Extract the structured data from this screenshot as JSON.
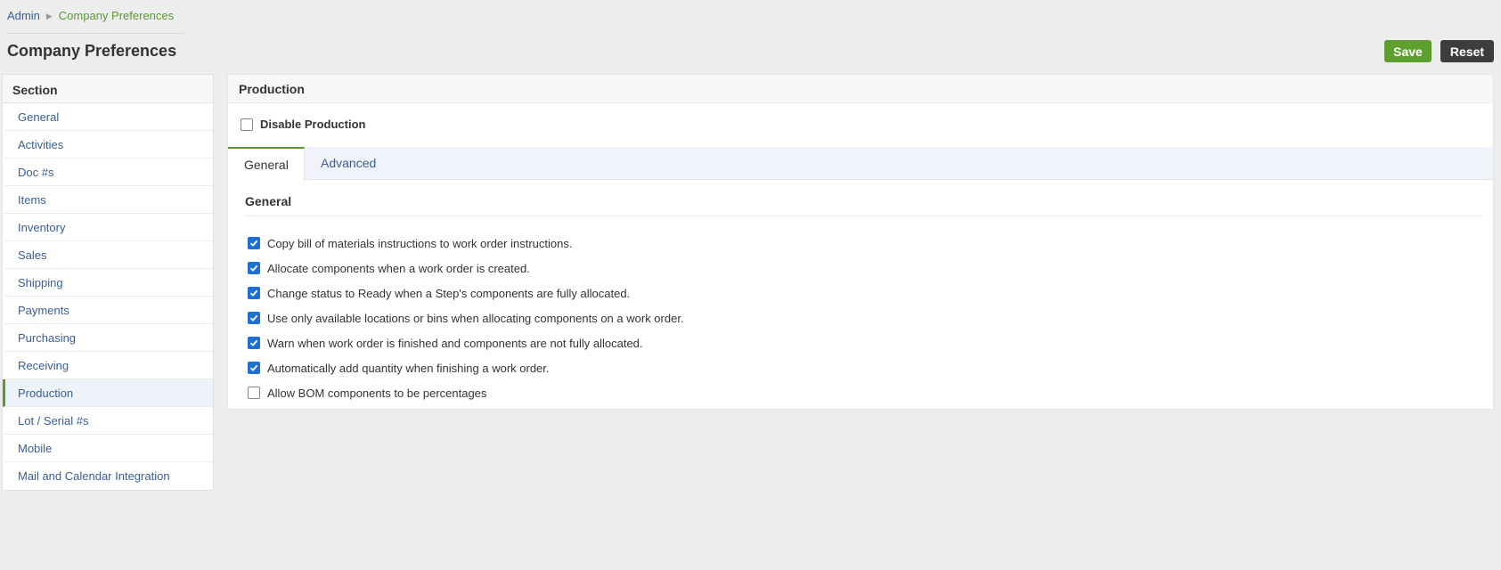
{
  "breadcrumb": {
    "root": "Admin",
    "current": "Company Preferences"
  },
  "page_title": "Company Preferences",
  "actions": {
    "save": "Save",
    "reset": "Reset"
  },
  "sidebar": {
    "header": "Section",
    "items": [
      {
        "label": "General"
      },
      {
        "label": "Activities"
      },
      {
        "label": "Doc #s"
      },
      {
        "label": "Items"
      },
      {
        "label": "Inventory"
      },
      {
        "label": "Sales"
      },
      {
        "label": "Shipping"
      },
      {
        "label": "Payments"
      },
      {
        "label": "Purchasing"
      },
      {
        "label": "Receiving"
      },
      {
        "label": "Production",
        "active": true
      },
      {
        "label": "Lot / Serial #s"
      },
      {
        "label": "Mobile"
      },
      {
        "label": "Mail and Calendar Integration"
      }
    ]
  },
  "panel": {
    "title": "Production",
    "disable_label": "Disable Production",
    "disable_checked": false,
    "tabs": [
      {
        "label": "General",
        "active": true
      },
      {
        "label": "Advanced",
        "active": false
      }
    ],
    "section_title": "General",
    "options": [
      {
        "label": "Copy bill of materials instructions to work order instructions.",
        "checked": true
      },
      {
        "label": "Allocate components when a work order is created.",
        "checked": true
      },
      {
        "label": "Change status to Ready when a Step's components are fully allocated.",
        "checked": true
      },
      {
        "label": "Use only available locations or bins when allocating components on a work order.",
        "checked": true
      },
      {
        "label": "Warn when work order is finished and components are not fully allocated.",
        "checked": true
      },
      {
        "label": "Automatically add quantity when finishing a work order.",
        "checked": true
      },
      {
        "label": "Allow BOM components to be percentages",
        "checked": false
      }
    ]
  },
  "colors": {
    "accent_green": "#5f9f2f",
    "link_blue": "#3a5f95",
    "checkbox_blue": "#1f6fd1"
  }
}
